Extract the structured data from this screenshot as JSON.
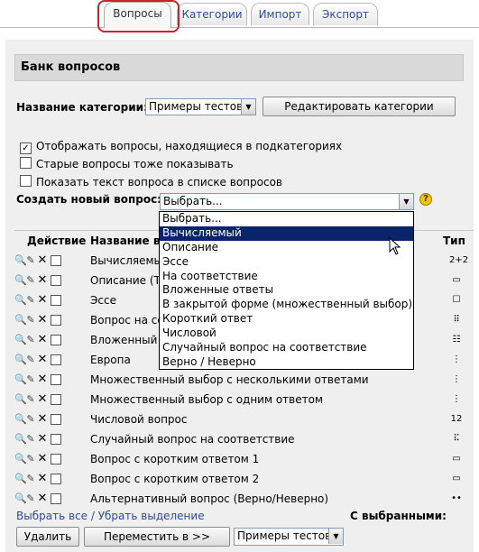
{
  "tabs": [
    {
      "label": "Вопросы",
      "active": true
    },
    {
      "label": "Категории",
      "active": false
    },
    {
      "label": "Импорт",
      "active": false
    },
    {
      "label": "Экспорт",
      "active": false
    }
  ],
  "bank": {
    "title": "Банк вопросов"
  },
  "category": {
    "label": "Название категории:",
    "selected": "Примеры тестов",
    "edit_button": "Редактировать категории"
  },
  "options": {
    "show_subcategories": {
      "label": "Отображать вопросы, находящиеся в подкатегориях",
      "checked": true
    },
    "show_old": {
      "label": "Старые вопросы тоже показывать",
      "checked": false
    },
    "show_text": {
      "label": "Показать текст вопроса в списке вопросов",
      "checked": false
    }
  },
  "create": {
    "label": "Создать новый вопрос:",
    "selected": "Выбрать...",
    "help_icon": "?"
  },
  "dropdown": {
    "items": [
      "Выбрать...",
      "Вычисляемый",
      "Описание",
      "Эссе",
      "На соответствие",
      "Вложенные ответы",
      "В закрытой форме (множественный выбор)",
      "Короткий ответ",
      "Числовой",
      "Случайный вопрос на соответствие",
      "Верно / Неверно"
    ],
    "highlighted_index": 1
  },
  "table": {
    "headers": {
      "action": "Действие",
      "name": "Название вопроса",
      "type": "Тип"
    },
    "rows": [
      {
        "name": "Вычисляемый",
        "type_icon": "2+2"
      },
      {
        "name": "Описание (Те",
        "type_icon": "▭"
      },
      {
        "name": "Эссе",
        "type_icon": "☐"
      },
      {
        "name": "Вопрос на со",
        "type_icon": "⠿"
      },
      {
        "name": "Вложенный в",
        "type_icon": "☷"
      },
      {
        "name": "Европа",
        "type_icon": "⋮"
      },
      {
        "name": "Множественный выбор с несколькими ответами",
        "type_icon": "⋮"
      },
      {
        "name": "Множественный выбор с одним ответом",
        "type_icon": "⋮"
      },
      {
        "name": "Числовой вопрос",
        "type_icon": "12"
      },
      {
        "name": "Случайный вопрос на соответствие",
        "type_icon": "⠯"
      },
      {
        "name": "Вопрос с коротким ответом 1",
        "type_icon": "▭"
      },
      {
        "name": "Вопрос с коротким ответом 2",
        "type_icon": "▭"
      },
      {
        "name": "Альтернативный вопрос (Верно/Неверно)",
        "type_icon": "••"
      }
    ]
  },
  "footer": {
    "select_all": "Выбрать все",
    "separator": "/",
    "deselect": "Убрать выделение",
    "with_selected": "С выбранными:",
    "delete_button": "Удалить",
    "move_button": "Переместить в >>",
    "target_category": "Примеры тестов"
  },
  "colors": {
    "link": "#2b4c9a",
    "highlight": "#0a246a",
    "circle": "#d0202a",
    "panel": "#efefef"
  }
}
